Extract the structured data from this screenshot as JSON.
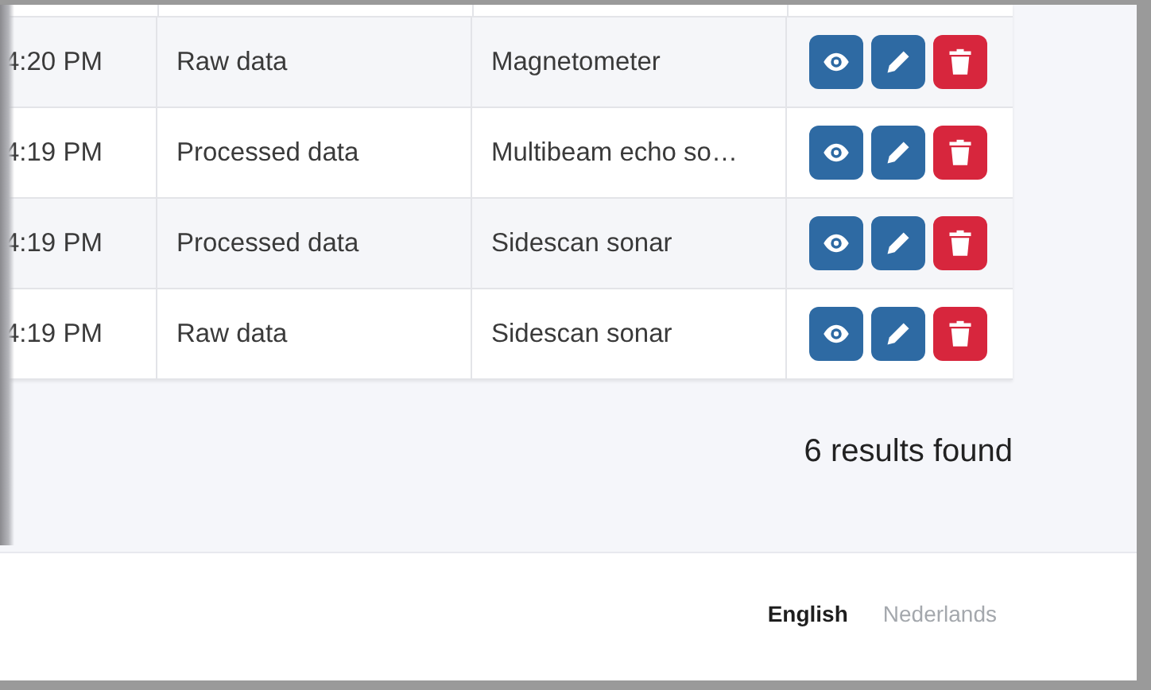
{
  "table": {
    "rows": [
      {
        "column_1": "4:20 PM",
        "column_2": "Raw data",
        "column_3": "Magnetometer",
        "actions": [
          {
            "kind": "view"
          },
          {
            "kind": "edit"
          },
          {
            "kind": "delete"
          }
        ]
      },
      {
        "column_1": "4:19 PM",
        "column_2": "Processed data",
        "column_3": "Multibeam echo so…",
        "actions": [
          {
            "kind": "view"
          },
          {
            "kind": "edit"
          },
          {
            "kind": "delete"
          }
        ]
      },
      {
        "column_1": "4:19 PM",
        "column_2": "Processed data",
        "column_3": "Sidescan sonar",
        "actions": [
          {
            "kind": "view"
          },
          {
            "kind": "edit"
          },
          {
            "kind": "delete"
          }
        ]
      },
      {
        "column_1": "4:19 PM",
        "column_2": "Raw data",
        "column_3": "Sidescan sonar",
        "actions": [
          {
            "kind": "view"
          },
          {
            "kind": "edit"
          },
          {
            "kind": "delete"
          }
        ]
      }
    ]
  },
  "results_count": "6 results found",
  "footer": {
    "languages": [
      {
        "label": "English",
        "selected": true
      },
      {
        "label": "Nederlands",
        "selected": false
      }
    ]
  }
}
